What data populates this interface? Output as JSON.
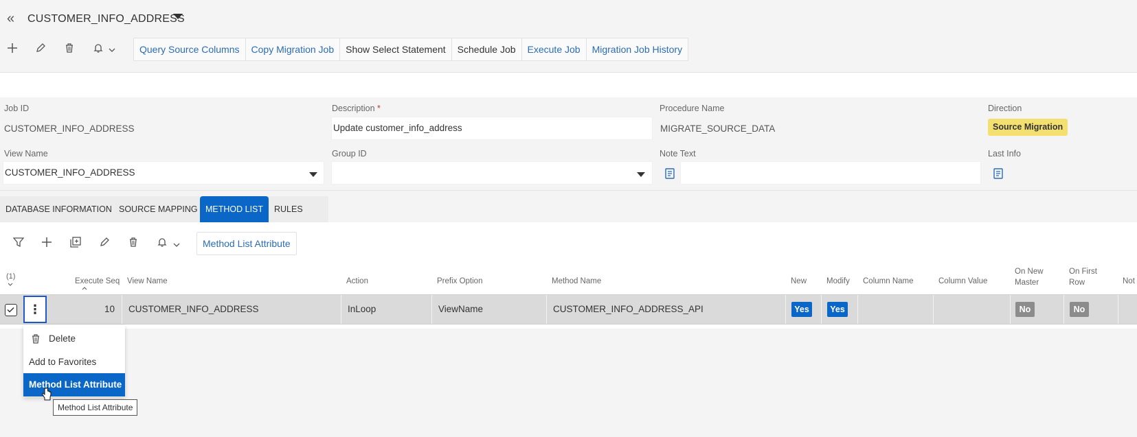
{
  "header": {
    "title": "CUSTOMER_INFO_ADDRESS",
    "actions": [
      "Query Source Columns",
      "Copy Migration Job",
      "Show Select Statement",
      "Schedule Job",
      "Execute Job",
      "Migration Job History"
    ]
  },
  "form": {
    "job_id_label": "Job ID",
    "job_id": "CUSTOMER_INFO_ADDRESS",
    "description_label": "Description",
    "required_mark": "*",
    "description": "Update customer_info_address",
    "procedure_label": "Procedure Name",
    "procedure": "MIGRATE_SOURCE_DATA",
    "direction_label": "Direction",
    "direction": "Source Migration",
    "view_name_label": "View Name",
    "view_name": "CUSTOMER_INFO_ADDRESS",
    "group_id_label": "Group ID",
    "group_id": "",
    "note_text_label": "Note Text",
    "note_text": "",
    "last_info_label": "Last Info"
  },
  "tabs": [
    "DATABASE INFORMATION",
    "SOURCE MAPPING",
    "METHOD LIST",
    "RULES"
  ],
  "active_tab": "METHOD LIST",
  "method_list": {
    "attr_button": "Method List Attribute",
    "selection_count": "(1)",
    "columns": {
      "execute_seq": "Execute Seq",
      "view_name": "View Name",
      "action": "Action",
      "prefix_option": "Prefix Option",
      "method_name": "Method Name",
      "new": "New",
      "modify": "Modify",
      "column_name": "Column Name",
      "column_value": "Column Value",
      "on_new_master_1": "On New",
      "on_new_master_2": "Master",
      "on_first_row_1": "On First",
      "on_first_row_2": "Row",
      "not": "Not"
    },
    "row": {
      "execute_seq": "10",
      "view_name": "CUSTOMER_INFO_ADDRESS",
      "action": "InLoop",
      "prefix_option": "ViewName",
      "method_name": "CUSTOMER_INFO_ADDRESS_API",
      "new": "Yes",
      "modify": "Yes",
      "column_name": "",
      "column_value": "",
      "on_new_master": "No",
      "on_first_row": "No"
    }
  },
  "context_menu": {
    "delete": "Delete",
    "favorites": "Add to Favorites",
    "attribute": "Method List Attribute",
    "tooltip": "Method List Attribute"
  },
  "colors": {
    "accent": "#0b67c7",
    "link": "#2a6cb6",
    "badge_yellow": "#f4e070",
    "chip_no": "#8c8c8c"
  }
}
